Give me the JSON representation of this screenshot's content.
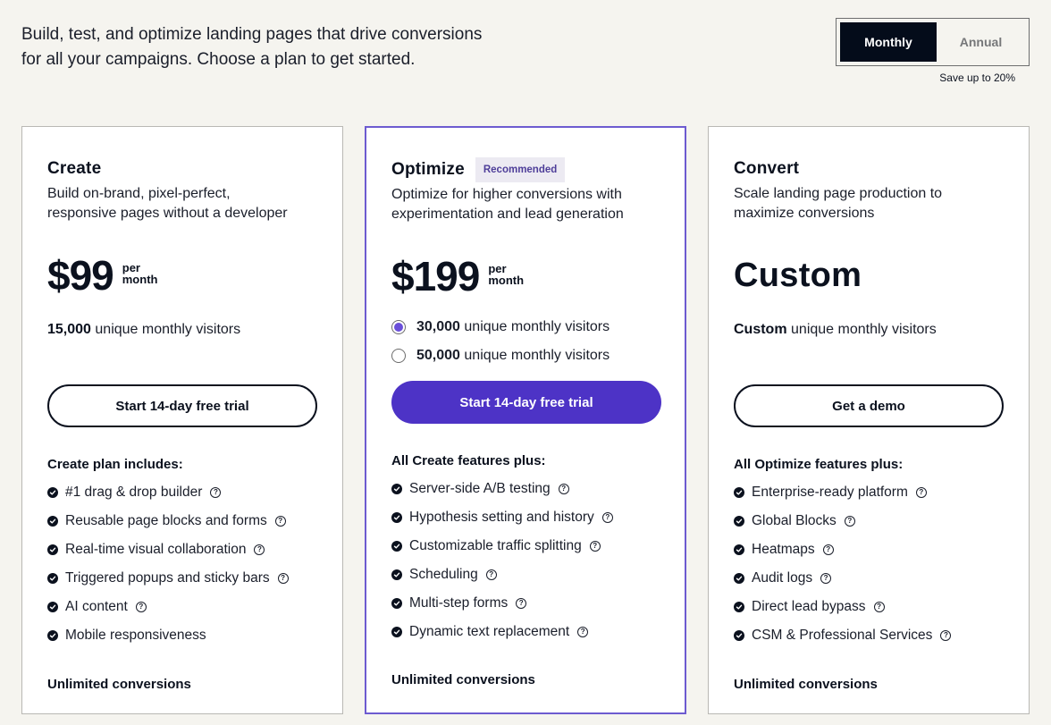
{
  "intro": {
    "line1": "Build, test, and optimize landing pages that drive conversions",
    "line2": "for all your campaigns. Choose a plan to get started."
  },
  "billing": {
    "options": [
      {
        "label": "Monthly",
        "active": true
      },
      {
        "label": "Annual",
        "active": false
      }
    ],
    "save_note": "Save up to 20%"
  },
  "colors": {
    "background": "#f5f4ef",
    "ink": "#0b111e",
    "accent": "#4d33c6",
    "featured_border": "#6d5bd0",
    "badge_bg": "#eceaf2",
    "badge_text": "#4e3e99"
  },
  "plans": [
    {
      "name": "Create",
      "description_line1": "Build on-brand, pixel-perfect,",
      "description_line2": "responsive pages without a developer",
      "price": "$99",
      "per_line1": "per",
      "per_line2": "month",
      "visitors_value": "15,000",
      "visitors_suffix": "unique monthly visitors",
      "cta": "Start 14-day free trial",
      "includes_title": "Create plan includes:",
      "features": [
        {
          "label": "#1 drag & drop builder",
          "help": true
        },
        {
          "label": "Reusable page blocks and forms",
          "help": true
        },
        {
          "label": "Real-time visual collaboration",
          "help": true
        },
        {
          "label": "Triggered popups and sticky bars",
          "help": true
        },
        {
          "label": "AI content",
          "help": true
        },
        {
          "label": "Mobile responsiveness",
          "help": false
        }
      ],
      "footer": "Unlimited conversions"
    },
    {
      "name": "Optimize",
      "badge": "Recommended",
      "description_line1": "Optimize for higher conversions with",
      "description_line2": "experimentation and lead generation",
      "price": "$199",
      "per_line1": "per",
      "per_line2": "month",
      "visitor_options": [
        {
          "value": "30,000",
          "suffix": "unique monthly visitors",
          "selected": true
        },
        {
          "value": "50,000",
          "suffix": "unique monthly visitors",
          "selected": false
        }
      ],
      "cta": "Start 14-day free trial",
      "includes_title": "All Create features plus:",
      "features": [
        {
          "label": "Server-side A/B testing",
          "help": true
        },
        {
          "label": "Hypothesis setting and history",
          "help": true
        },
        {
          "label": "Customizable traffic splitting",
          "help": true
        },
        {
          "label": "Scheduling",
          "help": true
        },
        {
          "label": "Multi-step forms",
          "help": true
        },
        {
          "label": "Dynamic text replacement",
          "help": true
        }
      ],
      "footer": "Unlimited conversions"
    },
    {
      "name": "Convert",
      "description_line1": "Scale landing page production to",
      "description_line2": "maximize conversions",
      "price": "Custom",
      "visitors_value": "Custom",
      "visitors_suffix": "unique monthly visitors",
      "cta": "Get a demo",
      "includes_title": "All Optimize features plus:",
      "features": [
        {
          "label": "Enterprise-ready platform",
          "help": true
        },
        {
          "label": "Global Blocks",
          "help": true
        },
        {
          "label": "Heatmaps",
          "help": true
        },
        {
          "label": "Audit logs",
          "help": true
        },
        {
          "label": "Direct lead bypass",
          "help": true
        },
        {
          "label": "CSM & Professional Services",
          "help": true
        }
      ],
      "footer": "Unlimited conversions"
    }
  ],
  "icons": {
    "check": "check-circle-icon",
    "help": "question-circle-icon",
    "help_glyph": "?"
  }
}
